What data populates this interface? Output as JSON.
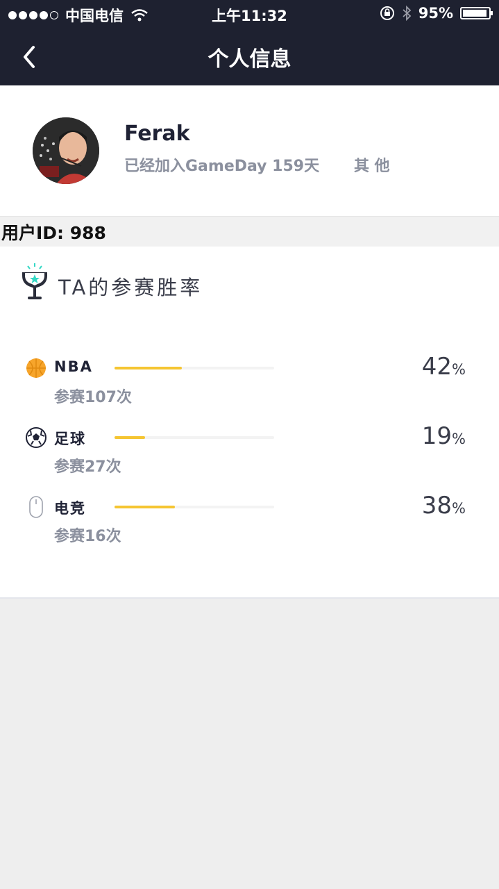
{
  "status_bar": {
    "carrier": "中国电信",
    "time": "上午11:32",
    "battery": "95%",
    "battery_level": 0.95
  },
  "nav": {
    "title": "个人信息",
    "back_icon": "chevron-left-icon"
  },
  "profile": {
    "username": "Ferak",
    "joined_text": "已经加入GameDay 159天",
    "other_label": "其 他"
  },
  "user_id": "用户ID: 988",
  "stats": {
    "title": "TA的参赛胜率",
    "accent_color": "#33d8c5",
    "bar_color": "#f5c532",
    "items": [
      {
        "icon": "basketball-icon",
        "label": "NBA",
        "percent": 42,
        "percent_text": "42",
        "count": "参赛107次"
      },
      {
        "icon": "soccer-ball-icon",
        "label": "足球",
        "percent": 19,
        "percent_text": "19",
        "count": "参赛27次"
      },
      {
        "icon": "mouse-icon",
        "label": "电竞",
        "percent": 38,
        "percent_text": "38",
        "count": "参赛16次"
      }
    ],
    "percent_sign": "%"
  }
}
